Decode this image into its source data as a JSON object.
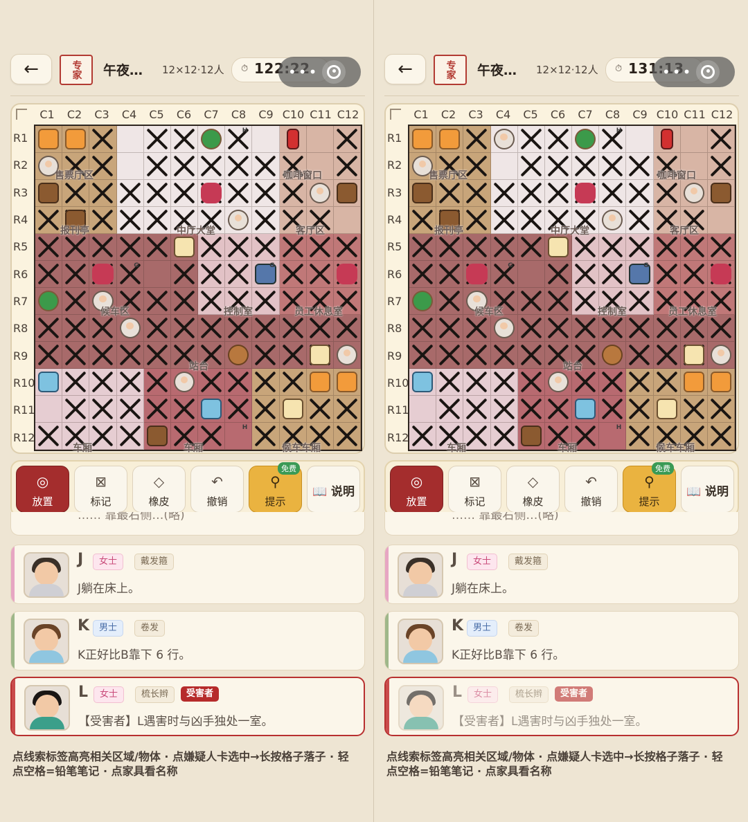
{
  "panels": [
    {
      "back_icon": "arrow-left-icon",
      "level_badge": "专家",
      "title": "午夜…",
      "subtitle": "12×12·12人",
      "timer": "122:22",
      "columns": [
        "C1",
        "C2",
        "C3",
        "C4",
        "C5",
        "C6",
        "C7",
        "C8",
        "C9",
        "C10",
        "C11",
        "C12"
      ],
      "rows": [
        "R1",
        "R2",
        "R3",
        "R4",
        "R5",
        "R6",
        "R7",
        "R8",
        "R9",
        "R10",
        "R11",
        "R12"
      ],
      "room_labels": [
        "售票厅区",
        "咖啡窗口",
        "报刊亭",
        "中厅大堂",
        "客厅区",
        "候车区",
        "控制室",
        "员工休息室",
        "站台",
        "车厢",
        "车厢",
        "候车车厢"
      ],
      "tools": [
        "放置",
        "标记",
        "橡皮",
        "撤销",
        "提示",
        "说明"
      ],
      "free_badge": "免费",
      "partial_clue": "…… 靠最右侧…(略)",
      "clues": [
        {
          "letter": "J",
          "gender": "女士",
          "trait": "戴发箍",
          "desc": "J躺在床上。"
        },
        {
          "letter": "K",
          "gender": "男士",
          "trait": "卷发",
          "desc": "K正好比B靠下 6 行。"
        },
        {
          "letter": "L",
          "gender": "女士",
          "trait": "梳长辫",
          "victim": "受害者",
          "desc": "【受害者】L遇害时与凶手独处一室。"
        }
      ],
      "footer": "点线索标签高亮相关区域/物体 · 点嫌疑人卡选中→长按格子落子 · 轻点空格=铅笔笔记 · 点家具看名称"
    },
    {
      "back_icon": "arrow-left-icon",
      "level_badge": "专家",
      "title": "午夜…",
      "subtitle": "12×12·12人",
      "timer": "131:13",
      "columns": [
        "C1",
        "C2",
        "C3",
        "C4",
        "C5",
        "C6",
        "C7",
        "C8",
        "C9",
        "C10",
        "C11",
        "C12"
      ],
      "rows": [
        "R1",
        "R2",
        "R3",
        "R4",
        "R5",
        "R6",
        "R7",
        "R8",
        "R9",
        "R10",
        "R11",
        "R12"
      ],
      "room_labels": [
        "售票厅区",
        "咖啡窗口",
        "报刊亭",
        "中厅大堂",
        "客厅区",
        "候车区",
        "控制室",
        "员工休息室",
        "站台",
        "车厢",
        "车厢",
        "候车车厢"
      ],
      "tools": [
        "放置",
        "标记",
        "橡皮",
        "撤销",
        "提示",
        "说明"
      ],
      "free_badge": "免费",
      "partial_clue": "…… 靠最右侧…(略)",
      "clues": [
        {
          "letter": "J",
          "gender": "女士",
          "trait": "戴发箍",
          "desc": "J躺在床上。"
        },
        {
          "letter": "K",
          "gender": "男士",
          "trait": "卷发",
          "desc": "K正好比B靠下 6 行。"
        },
        {
          "letter": "L",
          "gender": "女士",
          "trait": "梳长辫",
          "victim": "受害者",
          "desc": "【受害者】L遇害时与凶手独处一室。"
        }
      ],
      "footer": "点线索标签高亮相关区域/物体 · 点嫌疑人卡选中→长按格子落子 · 轻点空格=铅笔笔记 · 点家具看名称"
    }
  ],
  "colors": {
    "accent_red": "#a42d2d",
    "hint_gold": "#eab340",
    "free_green": "#3a9a55",
    "background": "#eee5d3"
  }
}
